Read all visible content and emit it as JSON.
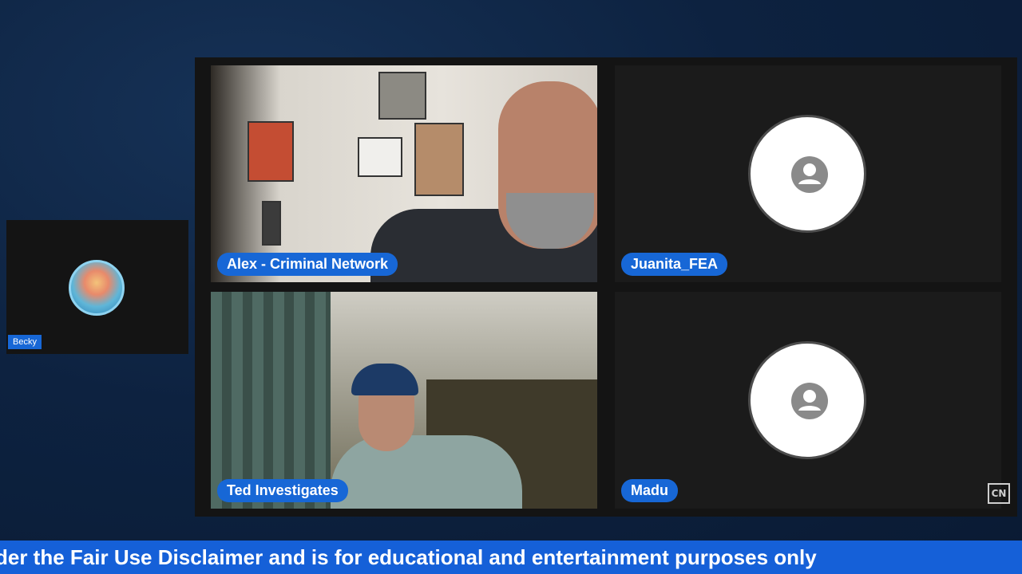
{
  "participants": [
    {
      "name": "Alex - Criminal Network",
      "video": true
    },
    {
      "name": "Juanita_FEA",
      "video": false,
      "avatar_icon": "user-placeholder-icon"
    },
    {
      "name": "Ted Investigates",
      "video": true
    },
    {
      "name": "Madu",
      "video": false,
      "avatar_icon": "user-placeholder-icon"
    }
  ],
  "side_participant": {
    "name": "Becky",
    "avatar_icon": "profile-photo"
  },
  "logo": {
    "text": "CN"
  },
  "ticker": {
    "text": "der the Fair Use Disclaimer and is for educational and entertainment purposes only"
  },
  "colors": {
    "name_tag": "#1767d6",
    "ticker": "#1560d8",
    "stage": "#141414"
  }
}
